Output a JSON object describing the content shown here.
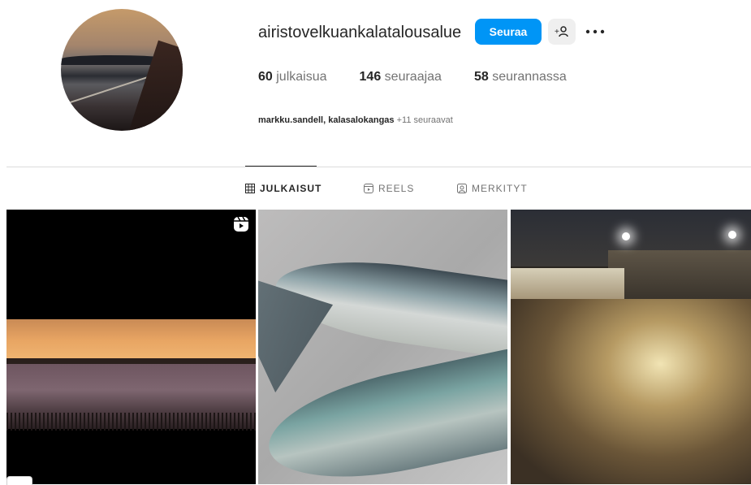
{
  "profile": {
    "username": "airistovelkuankalatalousalue",
    "follow_label": "Seuraa",
    "avatar_icon": "profile-photo-boat-sunset"
  },
  "stats": {
    "posts_count": "60",
    "posts_label": "julkaisua",
    "followers_count": "146",
    "followers_label": "seuraajaa",
    "following_count": "58",
    "following_label": "seurannassa"
  },
  "followed_by": {
    "users": "markku.sandell, kalasalokangas",
    "more": "+11 seuraavat"
  },
  "tabs": [
    {
      "label": "JULKAISUT",
      "icon": "grid-icon",
      "active": true
    },
    {
      "label": "REELS",
      "icon": "reels-icon",
      "active": false
    },
    {
      "label": "MERKITYT",
      "icon": "tagged-icon",
      "active": false
    }
  ],
  "colors": {
    "accent": "#0095f6",
    "text": "#262626",
    "muted": "#737373",
    "divider": "#dbdbdb"
  }
}
